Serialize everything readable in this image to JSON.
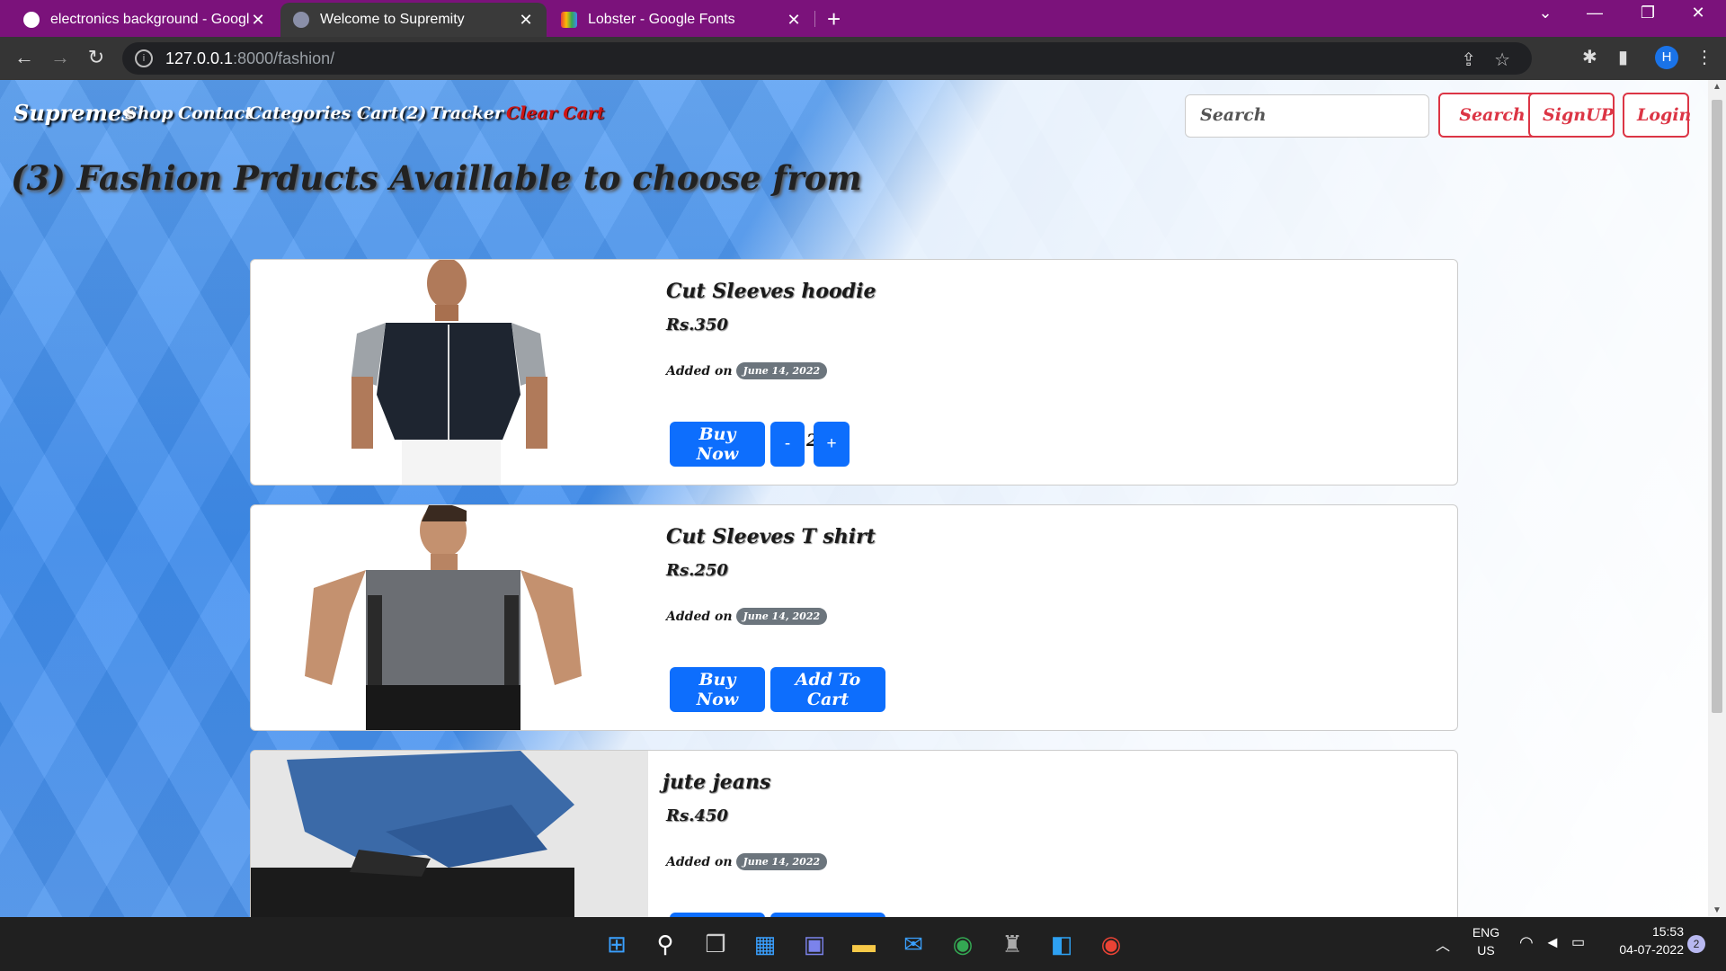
{
  "browser": {
    "tabs": [
      {
        "title": "electronics background - Google",
        "active": false
      },
      {
        "title": "Welcome to Supremity",
        "active": true
      },
      {
        "title": "Lobster - Google Fonts",
        "active": false
      }
    ],
    "url_host": "127.0.0.1",
    "url_path": ":8000/fashion/",
    "profile_initial": "H"
  },
  "nav": {
    "brand": "Supremes",
    "links": [
      "Shop",
      "Contact",
      "Categories",
      "Cart(2)",
      "Tracker"
    ],
    "clear_cart": "Clear Cart",
    "search_placeholder": "Search",
    "search_btn": "Search",
    "signup_btn": "SignUP",
    "login_btn": "Login"
  },
  "heading": "(3) Fashion Prducts Availlable to choose from",
  "products": [
    {
      "name": "Cut Sleeves hoodie",
      "price": "Rs.350",
      "added_label": "Added on",
      "date": "June 14, 2022",
      "buy": "Buy Now",
      "minus": "-",
      "qty": "2",
      "plus": "+"
    },
    {
      "name": "Cut Sleeves T shirt",
      "price": "Rs.250",
      "added_label": "Added on",
      "date": "June 14, 2022",
      "buy": "Buy Now",
      "add": "Add To Cart"
    },
    {
      "name": "jute jeans",
      "price": "Rs.450",
      "added_label": "Added on",
      "date": "June 14, 2022"
    }
  ],
  "taskbar": {
    "lang": "ENG",
    "region": "US",
    "time": "15:53",
    "date": "04-07-2022",
    "notif_count": "2"
  },
  "colors": {
    "tabstrip": "#7b127b",
    "primary": "#0d6efd",
    "danger": "#dc3545"
  }
}
